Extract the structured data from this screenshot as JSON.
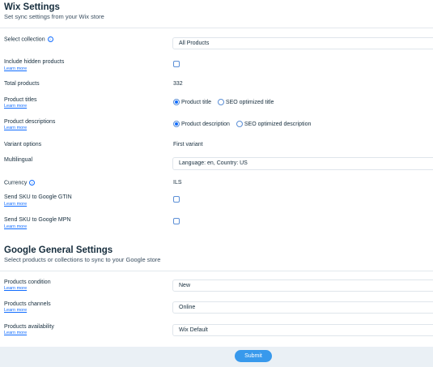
{
  "wix": {
    "title": "Wix Settings",
    "subtitle": "Set sync settings from your Wix store",
    "learn_more": "Learn more",
    "select_collection": {
      "label": "Select collection",
      "value": "All Products"
    },
    "include_hidden": {
      "label": "Include hidden products",
      "checked": false
    },
    "total_products": {
      "label": "Total products",
      "value": "332"
    },
    "product_titles": {
      "label": "Product titles",
      "options": [
        "Product title",
        "SEO optimized title"
      ],
      "selected": "Product title"
    },
    "product_descriptions": {
      "label": "Product descriptions",
      "options": [
        "Product description",
        "SEO optimized description"
      ],
      "selected": "Product description"
    },
    "variant_options": {
      "label": "Variant options",
      "value": "First variant"
    },
    "multilingual": {
      "label": "Multilingual",
      "value": "Language: en, Country: US"
    },
    "currency": {
      "label": "Currency",
      "value": "ILS"
    },
    "sku_gtin": {
      "label": "Send SKU to Google GTIN",
      "checked": false
    },
    "sku_mpn": {
      "label": "Send SKU to Google MPN",
      "checked": false
    }
  },
  "google": {
    "title": "Google General Settings",
    "subtitle": "Select products or collections to sync to your Google store",
    "learn_more": "Learn more",
    "condition": {
      "label": "Products condition",
      "value": "New"
    },
    "channels": {
      "label": "Products channels",
      "value": "Online"
    },
    "availability": {
      "label": "Products availability",
      "value": "Wix Default"
    }
  },
  "footer": {
    "submit_label": "Submit"
  },
  "colors": {
    "accent": "#116dff",
    "button": "#3899ec",
    "footer_bg": "#eaf0f5"
  }
}
